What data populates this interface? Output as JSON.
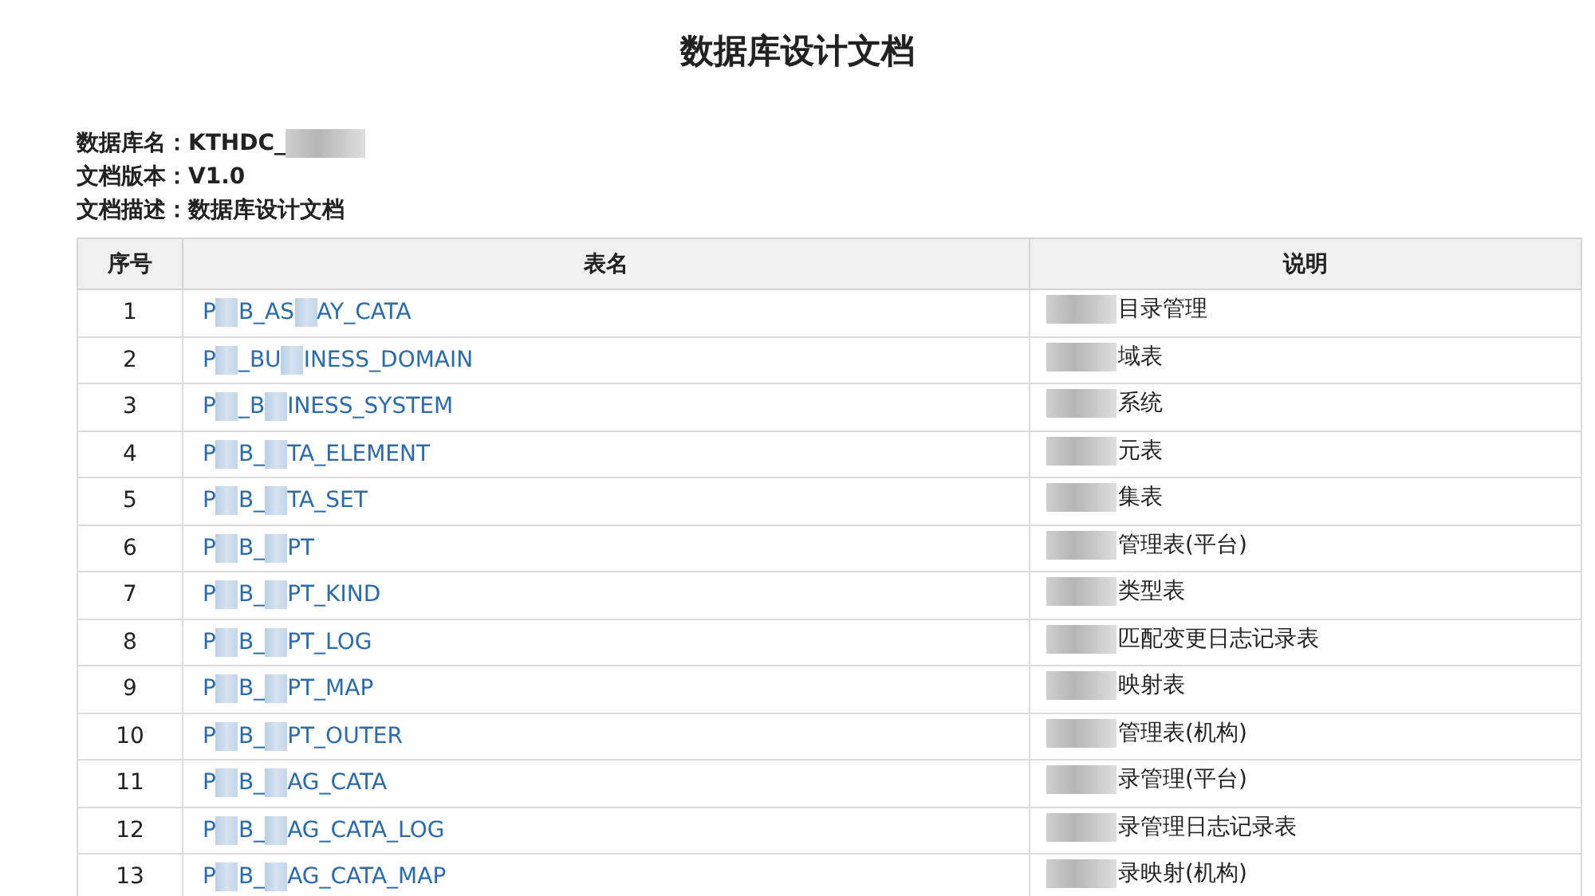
{
  "title": "数据库设计文档",
  "meta": [
    {
      "label": "数据库名：",
      "value": "KTHDC_",
      "masked": true
    },
    {
      "label": "文档版本：",
      "value": "V1.0",
      "masked": false
    },
    {
      "label": "文档描述：",
      "value": "数据库设计文档",
      "masked": false
    }
  ],
  "table": {
    "columns": [
      "序号",
      "表名",
      "说明"
    ],
    "rows": [
      {
        "no": "1",
        "name_parts": [
          "P",
          "B_AS",
          "AY_CATA"
        ],
        "desc": "目录管理"
      },
      {
        "no": "2",
        "name_parts": [
          "P",
          "_BU",
          "INESS_DOMAIN"
        ],
        "desc": "域表"
      },
      {
        "no": "3",
        "name_parts": [
          "P",
          "_B",
          "INESS_SYSTEM"
        ],
        "desc": "系统"
      },
      {
        "no": "4",
        "name_parts": [
          "P",
          "B_",
          "TA_ELEMENT"
        ],
        "desc": "元表"
      },
      {
        "no": "5",
        "name_parts": [
          "P",
          "B_",
          "TA_SET"
        ],
        "desc": "集表"
      },
      {
        "no": "6",
        "name_parts": [
          "P",
          "B_",
          "PT"
        ],
        "desc": "管理表(平台)"
      },
      {
        "no": "7",
        "name_parts": [
          "P",
          "B_",
          "PT_KIND"
        ],
        "desc": "类型表"
      },
      {
        "no": "8",
        "name_parts": [
          "P",
          "B_",
          "PT_LOG"
        ],
        "desc": "匹配变更日志记录表"
      },
      {
        "no": "9",
        "name_parts": [
          "P",
          "B_",
          "PT_MAP"
        ],
        "desc": "映射表"
      },
      {
        "no": "10",
        "name_parts": [
          "P",
          "B_",
          "PT_OUTER"
        ],
        "desc": "管理表(机构)"
      },
      {
        "no": "11",
        "name_parts": [
          "P",
          "B_",
          "AG_CATA"
        ],
        "desc": "录管理(平台)"
      },
      {
        "no": "12",
        "name_parts": [
          "P",
          "B_",
          "AG_CATA_LOG"
        ],
        "desc": "录管理日志记录表"
      },
      {
        "no": "13",
        "name_parts": [
          "P",
          "B_",
          "AG_CATA_MAP"
        ],
        "desc": "录映射(机构)"
      }
    ]
  }
}
